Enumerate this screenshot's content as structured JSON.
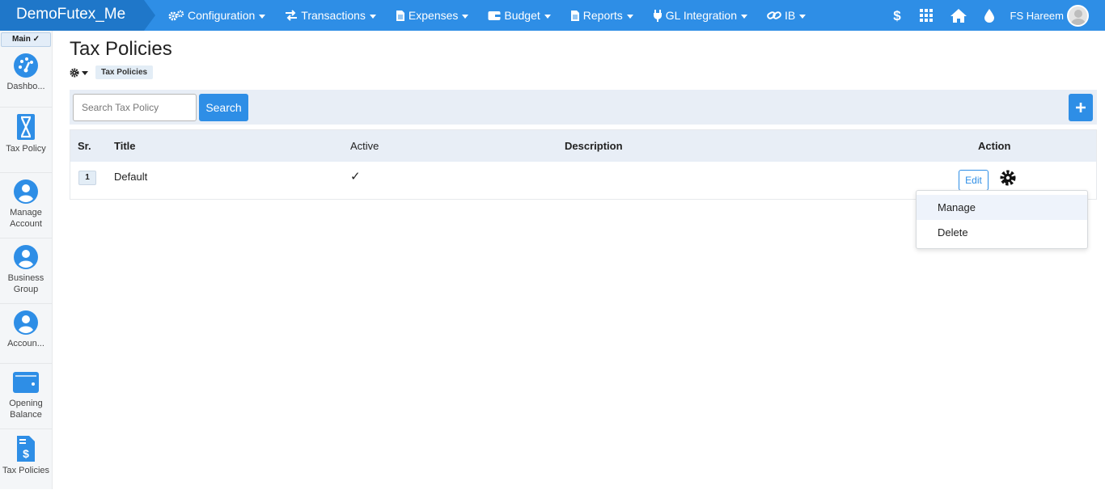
{
  "app": {
    "brand": "DemoFutex_Me"
  },
  "topnav": {
    "items": [
      {
        "label": "Configuration",
        "icon": "cogs-icon"
      },
      {
        "label": "Transactions",
        "icon": "exchange-icon"
      },
      {
        "label": "Expenses",
        "icon": "document-icon"
      },
      {
        "label": "Budget",
        "icon": "wallet-icon"
      },
      {
        "label": "Reports",
        "icon": "document-icon"
      },
      {
        "label": "GL Integration",
        "icon": "plug-icon"
      },
      {
        "label": "IB",
        "icon": "link-icon"
      }
    ],
    "right_icons": [
      "dollar-icon",
      "grid-icon",
      "home-icon",
      "drop-icon"
    ],
    "user_name": "FS Hareem"
  },
  "sidebar": {
    "main_tab": "Main ✓",
    "items": [
      {
        "label": "Dashbo...",
        "icon": "dashboard-icon"
      },
      {
        "label": "Tax Policy",
        "icon": "hourglass-icon"
      },
      {
        "label": "Manage Account",
        "icon": "user-circle-icon"
      },
      {
        "label": "Business Group",
        "icon": "user-circle-icon"
      },
      {
        "label": "Accoun...",
        "icon": "user-circle-icon"
      },
      {
        "label": "Opening Balance",
        "icon": "wallet-icon"
      },
      {
        "label": "Tax Policies",
        "icon": "invoice-dollar-icon"
      }
    ]
  },
  "page": {
    "title": "Tax Policies",
    "breadcrumb": "Tax Policies"
  },
  "search": {
    "placeholder": "Search Tax Policy",
    "value": "",
    "button": "Search"
  },
  "table": {
    "headers": {
      "sr": "Sr.",
      "title": "Title",
      "active": "Active",
      "description": "Description",
      "action": "Action"
    },
    "rows": [
      {
        "sr": "1",
        "title": "Default",
        "active": "✓",
        "description": "",
        "edit": "Edit"
      }
    ]
  },
  "action_menu": {
    "items": [
      "Manage",
      "Delete"
    ]
  },
  "colors": {
    "primary": "#2e8ee6",
    "brand_bg": "#1f77c9",
    "header_bg": "#e8eef6"
  }
}
